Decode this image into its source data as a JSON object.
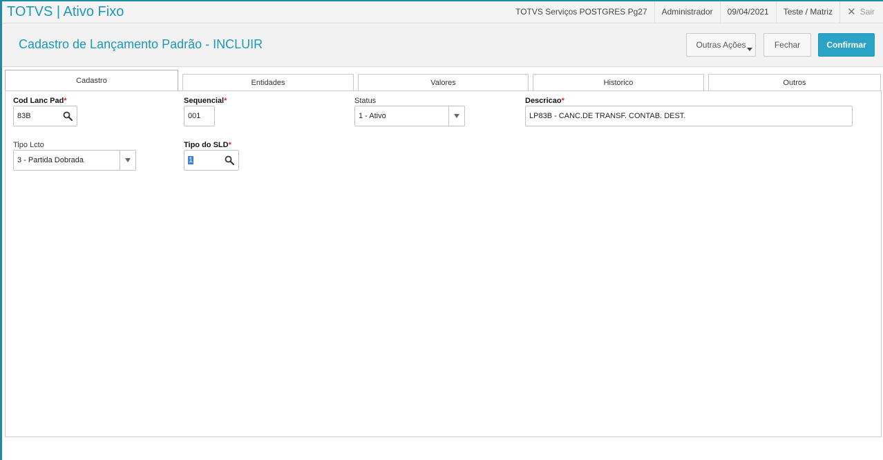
{
  "app": {
    "title": "TOTVS | Ativo Fixo"
  },
  "topbar": {
    "environment": "TOTVS Serviços POSTGRES Pg27",
    "user": "Administrador",
    "date": "09/04/2021",
    "branch": "Teste / Matriz",
    "exit_label": "Sair",
    "exit_icon": "close-icon"
  },
  "header": {
    "title": "Cadastro de Lançamento Padrão - INCLUIR",
    "buttons": {
      "other_actions": "Outras Ações",
      "close": "Fechar",
      "confirm": "Confirmar"
    }
  },
  "tabs": [
    {
      "label": "Cadastro",
      "active": true
    },
    {
      "label": "Entidades",
      "active": false
    },
    {
      "label": "Valores",
      "active": false
    },
    {
      "label": "Historico",
      "active": false
    },
    {
      "label": "Outros",
      "active": false
    }
  ],
  "form": {
    "cod_lanc_pad": {
      "label": "Cod Lanc Pad",
      "required": "*",
      "value": "83B"
    },
    "sequencial": {
      "label": "Sequencial",
      "required": "*",
      "value": "001"
    },
    "status": {
      "label": "Status",
      "value": "1 - Ativo"
    },
    "descricao": {
      "label": "Descricao",
      "required": "*",
      "value": "LP83B - CANC.DE TRANSF. CONTAB. DEST."
    },
    "tipo_lcto": {
      "label": "Tipo Lcto",
      "value": "3 - Partida Dobrada"
    },
    "tipo_sld": {
      "label": "Tipo do SLD",
      "required": "*",
      "value": "1"
    }
  },
  "colors": {
    "accent": "#1b98b8",
    "confirm": "#2aa3c6",
    "required": "#e02020"
  }
}
